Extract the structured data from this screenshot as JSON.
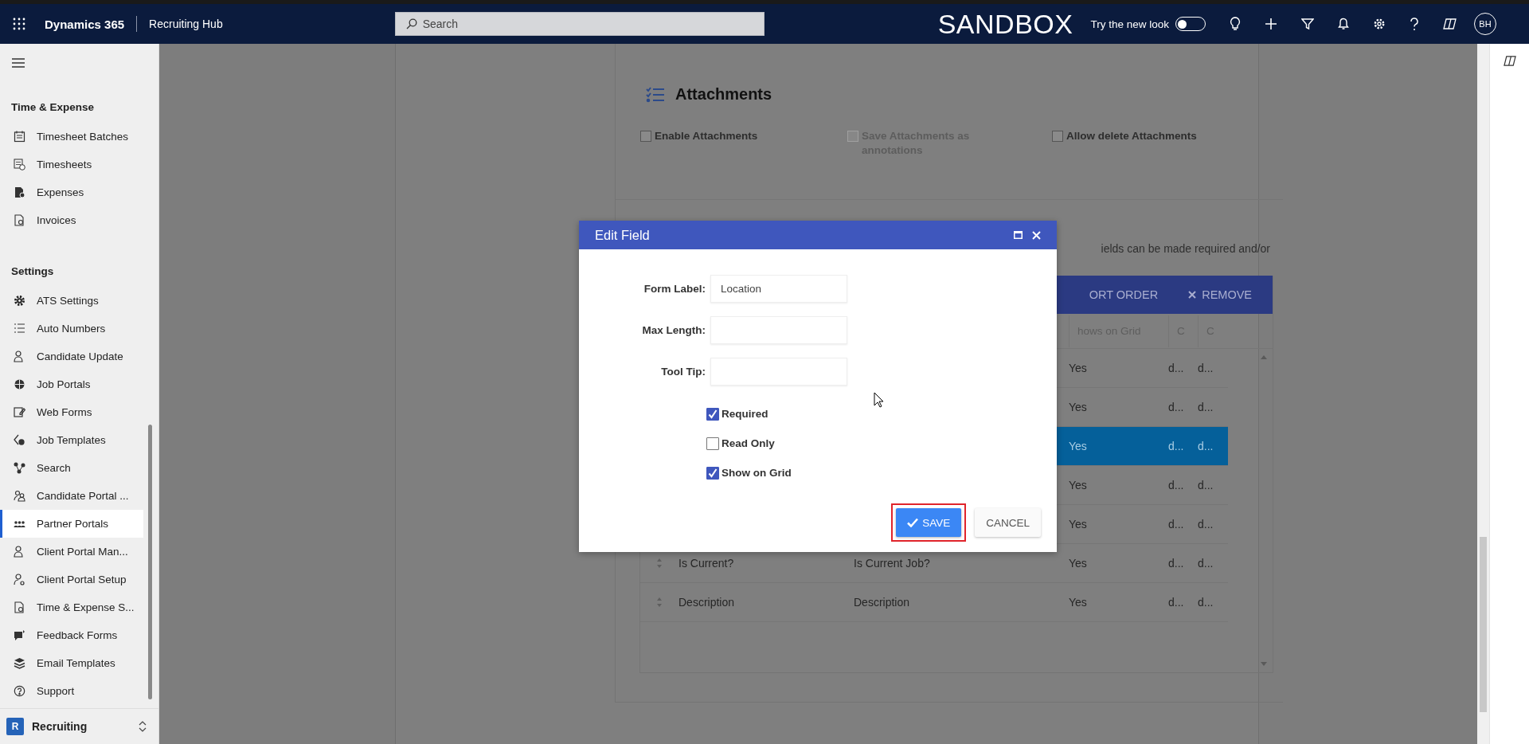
{
  "top_bar": {
    "app_name": "Dynamics 365",
    "area": "Recruiting Hub",
    "search": {
      "placeholder": "Search"
    },
    "environment": "SANDBOX",
    "new_look": {
      "label": "Try the new look",
      "on": false
    },
    "avatar": "BH"
  },
  "sidebar": {
    "sections": [
      {
        "title": "Time & Expense",
        "items": [
          {
            "label": "Timesheet Batches",
            "selected": false
          },
          {
            "label": "Timesheets",
            "selected": false
          },
          {
            "label": "Expenses",
            "selected": false
          },
          {
            "label": "Invoices",
            "selected": false
          }
        ]
      },
      {
        "title": "Settings",
        "items": [
          {
            "label": "ATS Settings",
            "selected": false
          },
          {
            "label": "Auto Numbers",
            "selected": false
          },
          {
            "label": "Candidate Update",
            "selected": false
          },
          {
            "label": "Job Portals",
            "selected": false
          },
          {
            "label": "Web Forms",
            "selected": false
          },
          {
            "label": "Job Templates",
            "selected": false
          },
          {
            "label": "Search",
            "selected": false
          },
          {
            "label": "Candidate Portal ...",
            "selected": false
          },
          {
            "label": "Partner Portals",
            "selected": true
          },
          {
            "label": "Client Portal Man...",
            "selected": false
          },
          {
            "label": "Client Portal Setup",
            "selected": false
          },
          {
            "label": "Time & Expense S...",
            "selected": false
          },
          {
            "label": "Feedback Forms",
            "selected": false
          },
          {
            "label": "Email Templates",
            "selected": false
          },
          {
            "label": "Support",
            "selected": false
          }
        ]
      }
    ],
    "area_switcher": {
      "badge": "R",
      "label": "Recruiting"
    }
  },
  "attachments": {
    "title": "Attachments",
    "options": [
      {
        "label": "Enable Attachments",
        "checked": false,
        "disabled": false
      },
      {
        "label": "Save Attachments as annotations",
        "checked": false,
        "disabled": true
      },
      {
        "label": "Allow delete Attachments",
        "checked": false,
        "disabled": false
      }
    ]
  },
  "fields_section": {
    "description": "ields can be made required and/or",
    "toolbar": [
      "ORT ORDER",
      "REMOVE"
    ],
    "columns": [
      "hows on Grid",
      "C",
      "C"
    ],
    "rows": [
      {
        "shows_on_grid": "Yes",
        "column_c1": "d...",
        "column_c2": "d...",
        "selected": false
      },
      {
        "shows_on_grid": "Yes",
        "column_c1": "d...",
        "column_c2": "d...",
        "selected": false
      },
      {
        "shows_on_grid": "Yes",
        "column_c1": "d...",
        "column_c2": "d...",
        "selected": true
      },
      {
        "shows_on_grid": "Yes",
        "column_c1": "d...",
        "column_c2": "d...",
        "selected": false
      },
      {
        "shows_on_grid": "Yes",
        "column_c1": "d...",
        "column_c2": "d...",
        "selected": false
      },
      {
        "label": "Is Current?",
        "form_label": "Is Current Job?",
        "shows_on_grid": "Yes",
        "column_c1": "d...",
        "column_c2": "d...",
        "selected": false
      },
      {
        "label": "Description",
        "form_label": "Description",
        "shows_on_grid": "Yes",
        "column_c1": "d...",
        "column_c2": "d...",
        "selected": false
      }
    ]
  },
  "dialog": {
    "title": "Edit Field",
    "fields": [
      {
        "label": "Form Label:",
        "value": "Location"
      },
      {
        "label": "Max Length:"
      },
      {
        "label": "Tool Tip:"
      }
    ],
    "options": [
      {
        "label": "Required",
        "checked": true
      },
      {
        "label": "Read Only",
        "checked": false
      },
      {
        "label": "Show on Grid",
        "checked": true
      }
    ],
    "buttons": [
      {
        "label": "SAVE",
        "kind": "primary",
        "highlighted": true
      },
      {
        "label": "CANCEL",
        "kind": "secondary",
        "highlighted": false
      }
    ]
  }
}
